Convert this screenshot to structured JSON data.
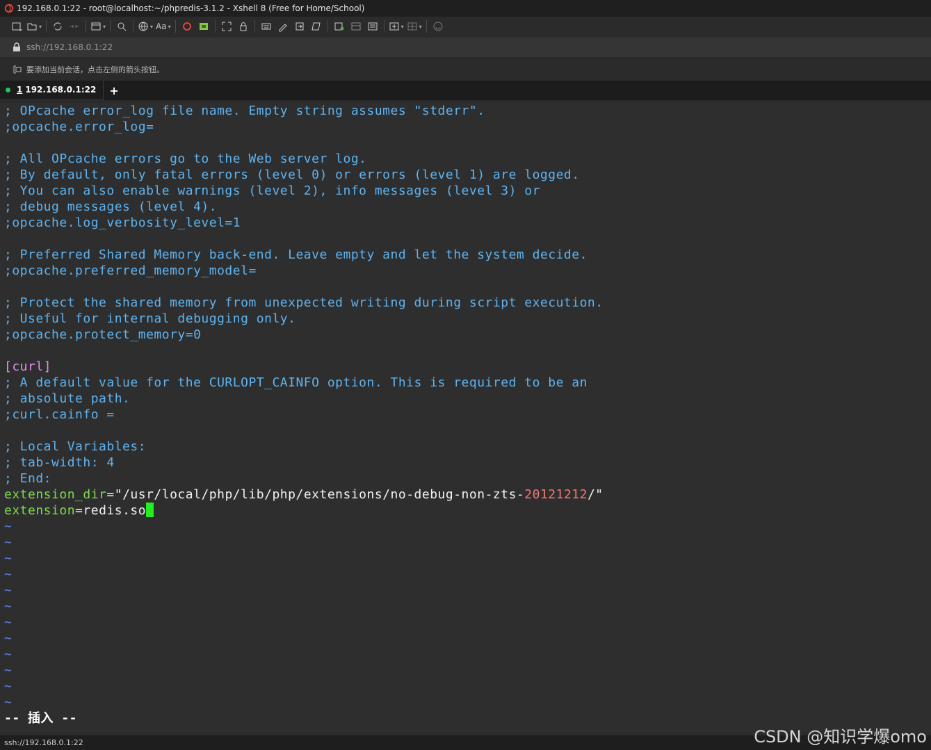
{
  "window": {
    "title": "192.168.0.1:22 - root@localhost:~/phpredis-3.1.2 - Xshell 8 (Free for Home/School)"
  },
  "toolbar": {
    "icons": [
      "new-session-icon",
      "open-session-icon",
      "reconnect-icon",
      "disconnect-icon",
      "new-tab-icon",
      "find-icon",
      "encoding-icon",
      "font-icon",
      "xshell-icon",
      "xftp-icon",
      "fullscreen-icon",
      "lock-icon",
      "keyboard-icon",
      "script-icon",
      "transfer-icon",
      "log-icon",
      "compose-icon",
      "layout-icon",
      "split-icon",
      "tile-icon",
      "help-icon"
    ],
    "font_label": "Aa"
  },
  "address": {
    "value": "ssh://192.168.0.1:22"
  },
  "hint": {
    "text": "要添加当前会话，点击左侧的箭头按钮。"
  },
  "tabs": [
    {
      "number": "1",
      "label": "192.168.0.1:22"
    }
  ],
  "tab_add_label": "+",
  "terminal": {
    "lines": [
      "; OPcache error_log file name. Empty string assumes \"stderr\".",
      ";opcache.error_log=",
      "",
      "; All OPcache errors go to the Web server log.",
      "; By default, only fatal errors (level 0) or errors (level 1) are logged.",
      "; You can also enable warnings (level 2), info messages (level 3) or",
      "; debug messages (level 4).",
      ";opcache.log_verbosity_level=1",
      "",
      "; Preferred Shared Memory back-end. Leave empty and let the system decide.",
      ";opcache.preferred_memory_model=",
      "",
      "; Protect the shared memory from unexpected writing during script execution.",
      "; Useful for internal debugging only.",
      ";opcache.protect_memory=0",
      "",
      "[curl]",
      "; A default value for the CURLOPT_CAINFO option. This is required to be an",
      "; absolute path.",
      ";curl.cainfo =",
      "",
      "; Local Variables:",
      "; tab-width: 4",
      "; End:"
    ],
    "ext_dir": {
      "key": "extension_dir",
      "eq": "=",
      "value_start": "\"/usr/local/php/lib/php/extensions/no-debug-non-zts-",
      "value_num": "20121212",
      "value_end": "/\""
    },
    "extension": {
      "key": "extension",
      "eq": "=",
      "value": "redis.so"
    },
    "tilde": "~",
    "mode_line": "-- 插入 --"
  },
  "status": {
    "text": "ssh://192.168.0.1:22"
  },
  "watermark": "CSDN @知识学爆omo",
  "colors": {
    "comment": "#5fb3f0",
    "section": "#e38fe8",
    "key": "#7ddc4e",
    "number": "#f07878",
    "tilde": "#5b84d8",
    "cursor": "#22ee22",
    "session_dot": "#22c55e"
  }
}
